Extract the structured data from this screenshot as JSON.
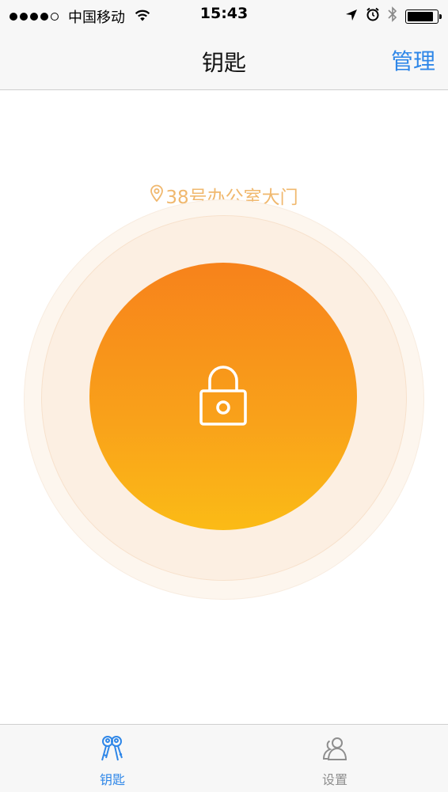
{
  "status_bar": {
    "carrier": "中国移动",
    "time": "15:43",
    "signal_bars_filled": 4,
    "signal_bars_total": 5,
    "icons": [
      "wifi-icon",
      "location-arrow-icon",
      "alarm-icon",
      "bluetooth-icon",
      "battery-icon"
    ],
    "battery_level": 0.9
  },
  "nav": {
    "title": "钥匙",
    "manage_label": "管理"
  },
  "main": {
    "location_icon": "location-pin-icon",
    "location_label": "38号办公室大门",
    "lock_icon": "padlock-icon"
  },
  "tab_bar": {
    "tabs": [
      {
        "label": "钥匙",
        "icon": "keys-icon",
        "active": true
      },
      {
        "label": "设置",
        "icon": "users-icon",
        "active": false
      }
    ]
  },
  "colors": {
    "accent_blue": "#2f87e8",
    "button_top": "#f7821b",
    "button_bottom": "#fbbb16",
    "location_text": "#f0b86e"
  }
}
